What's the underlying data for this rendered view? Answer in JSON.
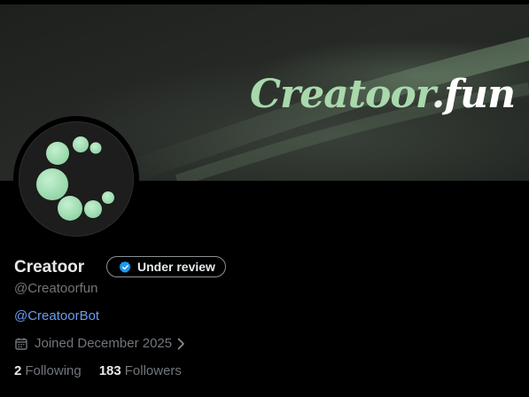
{
  "banner": {
    "logo_name": "Creatoor",
    "logo_dot": ".",
    "logo_tld": "fun"
  },
  "avatar": {
    "icon": "dots-c-logo-icon",
    "accent_color": "#a9dfb8"
  },
  "profile": {
    "display_name": "Creatoor",
    "badge_label": "Under review",
    "badge_icon": "verified-check-icon",
    "badge_icon_color": "#1d9bf0",
    "handle": "@Creatoorfun",
    "bio_link": "@CreatoorBot",
    "joined_icon": "calendar-icon",
    "joined_text": "Joined December 2025",
    "joined_chevron": "chevron-right-icon"
  },
  "stats": {
    "following_count": "2",
    "following_label": "Following",
    "followers_count": "183",
    "followers_label": "Followers"
  },
  "colors": {
    "background": "#000000",
    "link": "#6a9df0",
    "muted_text": "#71767b",
    "primary_text": "#e7e9ea",
    "logo_green": "#a9d8ac"
  }
}
